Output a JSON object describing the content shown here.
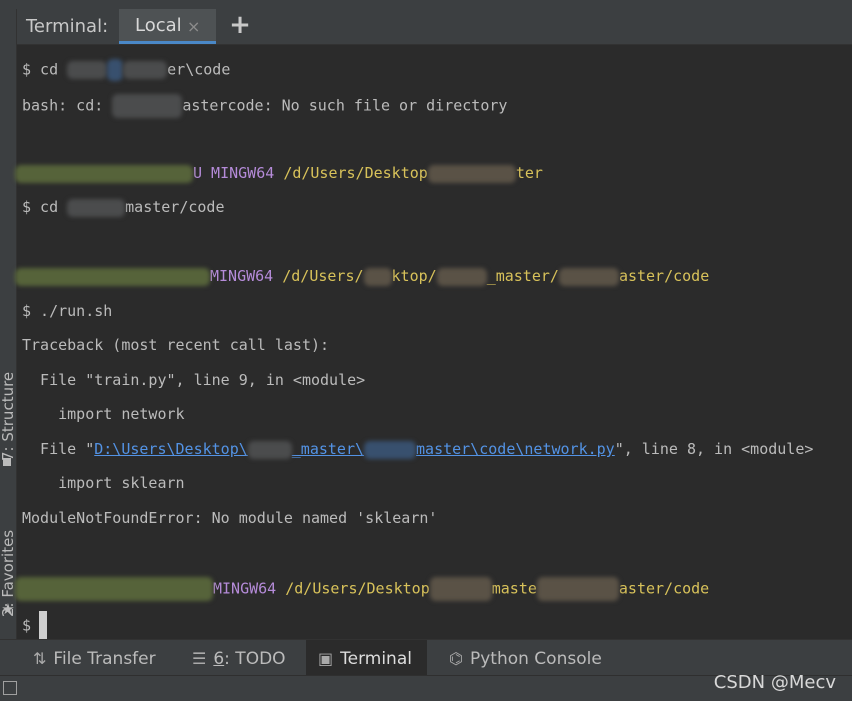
{
  "tabbar": {
    "title": "Terminal:",
    "tab_label": "Local",
    "close_glyph": "×",
    "add_glyph": "+"
  },
  "sidebar": {
    "structure_label": "7: Structure",
    "favorites_label": "2: Favorites"
  },
  "terminal": {
    "line1_prompt": "$ cd ",
    "line1_tail": "er\\code",
    "line2_a": "bash: cd: ",
    "line2_b": "astercode: No such file or directory",
    "line3_a": "U MINGW64 ",
    "line3_b": "/d/Users/Desktop",
    "line3_c": "ter",
    "line4_prompt": "$ cd ",
    "line4_tail": "master/code",
    "line5_a": "MINGW64 ",
    "line5_b": "/d/Users/",
    "line5_c": "ktop/",
    "line5_d": "_master/",
    "line5_e": "aster/code",
    "line6": "$ ./run.sh",
    "line7": "Traceback (most recent call last):",
    "line8": "  File \"train.py\", line 9, in <module>",
    "line9": "    import network",
    "line10_a": "  File \"",
    "line10_link_a": "D:\\Users\\Desktop\\",
    "line10_link_b": "_master\\",
    "line10_link_c": "master\\code\\network.py",
    "line10_b": "\", line 8, in <module>",
    "line11": "    import sklearn",
    "line12": "ModuleNotFoundError: No module named 'sklearn'",
    "line13_a": "MINGW64 ",
    "line13_b": "/d/Users/Desktop",
    "line13_c": "maste",
    "line13_d": "aster/code",
    "line14_prompt": "$"
  },
  "bottombar": {
    "file_transfer": "File Transfer",
    "todo_num": "6",
    "todo_rest": ": TODO",
    "terminal": "Terminal",
    "python_console": "Python Console"
  },
  "watermark": "CSDN @Mecv",
  "colors": {
    "background": "#2b2b2b",
    "path_yellow": "#d8c25a",
    "mingw_purple": "#b58bd9",
    "link_blue": "#5393e5",
    "accent": "#4a88c7"
  },
  "icons": {
    "file_transfer": "transfer-arrows-icon",
    "todo": "list-icon",
    "terminal": "terminal-icon",
    "python_console": "python-icon",
    "add": "plus-icon",
    "close": "close-icon"
  }
}
